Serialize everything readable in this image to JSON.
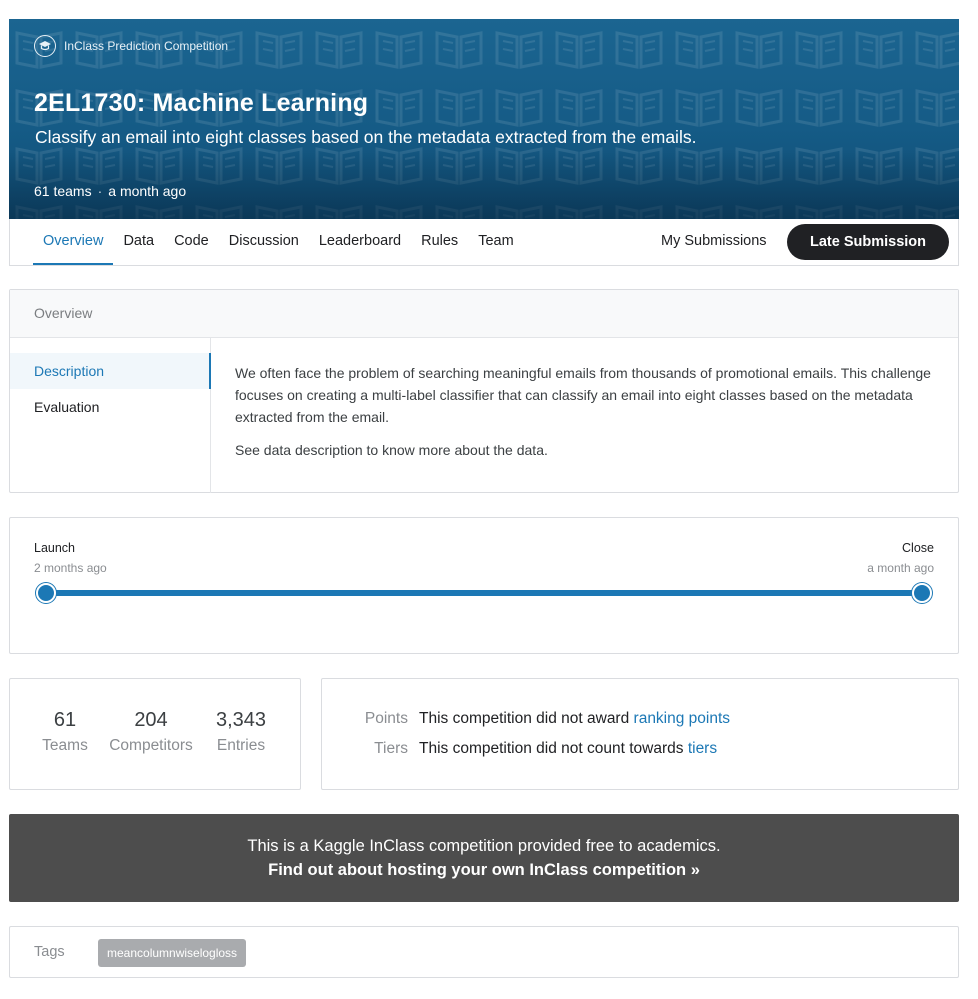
{
  "header": {
    "competition_type": "InClass Prediction Competition",
    "type_icon": "graduation-cap-icon",
    "title": "2EL1730: Machine Learning",
    "subtitle": "Classify an email into eight classes based on the metadata extracted from the emails.",
    "teams": "61 teams",
    "separator": "·",
    "time_ago": "a month ago",
    "banner_color": "#155b86"
  },
  "nav": {
    "tabs": [
      {
        "label": "Overview",
        "active": true
      },
      {
        "label": "Data"
      },
      {
        "label": "Code"
      },
      {
        "label": "Discussion"
      },
      {
        "label": "Leaderboard"
      },
      {
        "label": "Rules"
      },
      {
        "label": "Team"
      }
    ],
    "my_submissions": "My Submissions",
    "late_submission": "Late Submission"
  },
  "overview": {
    "heading": "Overview",
    "side_items": [
      {
        "label": "Description",
        "active": true
      },
      {
        "label": "Evaluation"
      }
    ],
    "paragraphs": [
      "We often face the problem of searching meaningful emails from thousands of promotional emails. This challenge focuses on creating a multi-label classifier that can classify an email into eight classes based on the metadata extracted from the email.",
      "See data description to know more about the data."
    ]
  },
  "timeline": {
    "launch_label": "Launch",
    "launch_time": "2 months ago",
    "close_label": "Close",
    "close_time": "a month ago",
    "progress": 1.0,
    "accent": "#1c78b5"
  },
  "stats": [
    {
      "value": "61",
      "label": "Teams"
    },
    {
      "value": "204",
      "label": "Competitors"
    },
    {
      "value": "3,343",
      "label": "Entries"
    }
  ],
  "points": {
    "points_key": "Points",
    "points_text": "This competition did not award ",
    "points_link": "ranking points",
    "tiers_key": "Tiers",
    "tiers_text": "This competition did not count towards ",
    "tiers_link": "tiers"
  },
  "inclass": {
    "line1": "This is a Kaggle InClass competition provided free to academics.",
    "line2": "Find out about hosting your own InClass competition »"
  },
  "tags": {
    "label": "Tags",
    "items": [
      "meancolumnwiselogloss"
    ]
  }
}
